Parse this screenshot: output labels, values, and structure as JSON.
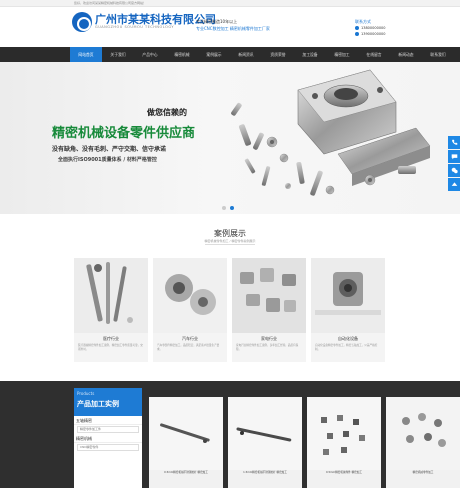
{
  "topbar": {
    "text": "您好，欢迎访问某某精密机械科技有限公司官方网站！"
  },
  "header": {
    "company_name": "广州市某某科技有限公司",
    "company_en": "GUANGZHOU SOUMOU TECHNOLOGY",
    "slogan_line1": "专注精密制造10年以上",
    "slogan_line2": "专业CNC数控加工 精密机械零件加工厂家",
    "contact_title": "联系方式",
    "phone1": "13800000000",
    "phone2": "13900000000"
  },
  "nav": {
    "items": [
      "网站首页",
      "关于我们",
      "产品中心",
      "精密机械",
      "案例展示",
      "新闻资讯",
      "资质荣誉",
      "加工设备",
      "精密加工",
      "在线留言",
      "新闻动态",
      "联系我们"
    ],
    "active_index": 0
  },
  "banner": {
    "line1": "做您信赖的",
    "line2": "精密机械设备零件供应商",
    "line3": "没有缺角、没有毛刺、严守交期、信守承诺",
    "line4": "全面执行ISO9001质量体系 / 材料严格管控",
    "slide_count": 2,
    "active_slide": 1
  },
  "cases_section": {
    "title": "案例展示",
    "subtitle": "精密机械零件加工 / 精密零件案例展示",
    "cards": [
      {
        "label": "医疗行业",
        "desc": "医疗器械精密零件加工案例，精密加工零件质量可靠，交期准时。"
      },
      {
        "label": "汽车行业",
        "desc": "汽车零部件精密加工，品质稳定，满足客户批量生产要求。"
      },
      {
        "label": "家电行业",
        "desc": "家电行业精密零件加工案例，多年加工经验，品质有保障。"
      },
      {
        "label": "自动化设备",
        "desc": "自动化设备精密零件加工，精密五轴加工，公差严格控制。"
      }
    ]
  },
  "products": {
    "head_en": "Products",
    "head_cn": "产品加工实例",
    "categories": [
      {
        "name": "五轴精密",
        "children": [
          "精密零件加工件"
        ]
      },
      {
        "name": "精密机械",
        "children": [
          "CNC精密零件"
        ]
      }
    ],
    "cards": [
      {
        "caption": "0.5mm精密机械不锈钢拉杆 精密加工"
      },
      {
        "caption": "1.5mm精密机械不锈钢拉杆 精密加工"
      },
      {
        "caption": "0.5mm精密机械零件 精密加工"
      },
      {
        "caption": "精密机械零件加工"
      }
    ]
  },
  "side_icons": [
    "phone-icon",
    "chat-icon",
    "wechat-icon",
    "top-icon"
  ],
  "colors": {
    "brand": "#1e7bd4",
    "green": "#178a3a",
    "nav_bg": "#2b2b2b"
  }
}
